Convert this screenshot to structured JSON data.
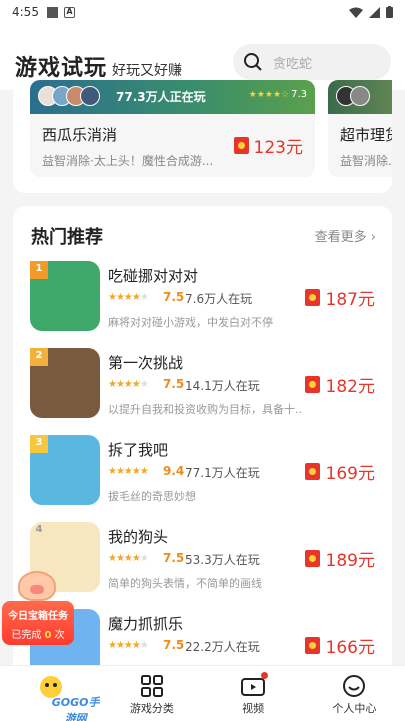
{
  "status_bar": {
    "time": "4:55"
  },
  "header": {
    "title": "游戏试玩",
    "subtitle": "好玩又好赚",
    "search_placeholder": "贪吃蛇"
  },
  "featured": [
    {
      "name": "西瓜乐消消",
      "desc": "益智消除·太上头！魔性合成游...",
      "price": "123元",
      "playing": "77.3万人正在玩",
      "rating": "7.3"
    },
    {
      "name": "超市理货",
      "desc": "益智消除..."
    }
  ],
  "hot": {
    "title": "热门推荐",
    "more": "查看更多",
    "items": [
      {
        "rank": "1",
        "name": "吃碰挪对对对",
        "stars": 3.5,
        "rating": "7.5",
        "players": "7.6万人在玩",
        "desc": "麻将对对碰小游戏，中发白对不停",
        "price": "187元",
        "thumb": "#3ea86a"
      },
      {
        "rank": "2",
        "name": "第一次挑战",
        "stars": 3.5,
        "rating": "7.5",
        "players": "14.1万人在玩",
        "desc": "以提升自我和投资收购为目标，具备十...",
        "price": "182元",
        "thumb": "#7a5a3e"
      },
      {
        "rank": "3",
        "name": "拆了我吧",
        "stars": 4.5,
        "rating": "9.4",
        "players": "77.1万人在玩",
        "desc": "拔毛丝的奇思妙想",
        "price": "169元",
        "thumb": "#5ab7e0"
      },
      {
        "rank": "4",
        "name": "我的狗头",
        "stars": 3.5,
        "rating": "7.5",
        "players": "53.3万人在玩",
        "desc": "简单的狗头表情，不简单的画线",
        "price": "189元",
        "thumb": "#f7e7c0"
      },
      {
        "rank": "5",
        "name": "魔力抓抓乐",
        "stars": 3.5,
        "rating": "7.5",
        "players": "22.2万人在玩",
        "desc": "",
        "price": "166元",
        "thumb": "#6fb3f0"
      }
    ]
  },
  "task_badge": {
    "title": "今日宝箱任务",
    "progress_prefix": "已完成",
    "count": "0",
    "suffix": "次"
  },
  "nav": [
    {
      "label": "",
      "icon": "home-icon"
    },
    {
      "label": "游戏分类",
      "icon": "grid-icon"
    },
    {
      "label": "视频",
      "icon": "video-icon"
    },
    {
      "label": "个人中心",
      "icon": "face-icon"
    }
  ],
  "watermark": "GOGO手游网"
}
